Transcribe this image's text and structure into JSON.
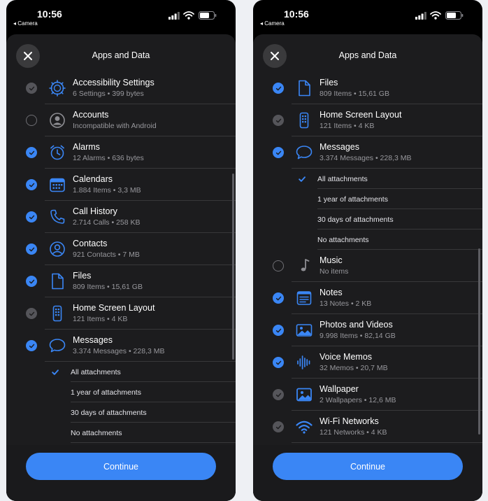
{
  "status": {
    "time": "10:56",
    "back_label": "◂ Camera"
  },
  "sheet": {
    "title": "Apps and Data",
    "continue_label": "Continue"
  },
  "left": [
    {
      "kind": "app",
      "name": "Accessibility Settings",
      "detail": "6 Settings • 399 bytes",
      "state": "gray",
      "icon": "accessibility-icon"
    },
    {
      "kind": "app",
      "name": "Accounts",
      "detail": "Incompatible with Android",
      "state": "off",
      "icon": "person-circle-icon"
    },
    {
      "kind": "app",
      "name": "Alarms",
      "detail": "12 Alarms • 636 bytes",
      "state": "on",
      "icon": "alarm-clock-icon"
    },
    {
      "kind": "app",
      "name": "Calendars",
      "detail": "1.884 Items • 3,3 MB",
      "state": "on",
      "icon": "calendar-icon"
    },
    {
      "kind": "app",
      "name": "Call History",
      "detail": "2.714 Calls • 258 KB",
      "state": "on",
      "icon": "phone-icon"
    },
    {
      "kind": "app",
      "name": "Contacts",
      "detail": "921 Contacts • 7 MB",
      "state": "on",
      "icon": "contact-icon"
    },
    {
      "kind": "app",
      "name": "Files",
      "detail": "809 Items • 15,61 GB",
      "state": "on",
      "icon": "file-icon"
    },
    {
      "kind": "app",
      "name": "Home Screen Layout",
      "detail": "121 Items • 4 KB",
      "state": "gray",
      "icon": "home-screen-icon"
    },
    {
      "kind": "app",
      "name": "Messages",
      "detail": "3.374 Messages • 228,3 MB",
      "state": "on",
      "icon": "message-bubble-icon"
    },
    {
      "kind": "sub",
      "label": "All attachments",
      "selected": true
    },
    {
      "kind": "sub",
      "label": "1 year of attachments",
      "selected": false
    },
    {
      "kind": "sub",
      "label": "30 days of attachments",
      "selected": false
    },
    {
      "kind": "sub",
      "label": "No attachments",
      "selected": false
    }
  ],
  "right": [
    {
      "kind": "app",
      "name": "Files",
      "detail": "809 Items • 15,61 GB",
      "state": "on",
      "icon": "file-icon"
    },
    {
      "kind": "app",
      "name": "Home Screen Layout",
      "detail": "121 Items • 4 KB",
      "state": "gray",
      "icon": "home-screen-icon"
    },
    {
      "kind": "app",
      "name": "Messages",
      "detail": "3.374 Messages • 228,3 MB",
      "state": "on",
      "icon": "message-bubble-icon"
    },
    {
      "kind": "sub",
      "label": "All attachments",
      "selected": true
    },
    {
      "kind": "sub",
      "label": "1 year of attachments",
      "selected": false
    },
    {
      "kind": "sub",
      "label": "30 days of attachments",
      "selected": false
    },
    {
      "kind": "sub",
      "label": "No attachments",
      "selected": false
    },
    {
      "kind": "app",
      "name": "Music",
      "detail": "No items",
      "state": "off",
      "icon": "music-note-icon"
    },
    {
      "kind": "app",
      "name": "Notes",
      "detail": "13 Notes • 2 KB",
      "state": "on",
      "icon": "notes-icon"
    },
    {
      "kind": "app",
      "name": "Photos and Videos",
      "detail": "9.998 Items • 82,14 GB",
      "state": "on",
      "icon": "photo-icon"
    },
    {
      "kind": "app",
      "name": "Voice Memos",
      "detail": "32 Memos • 20,7 MB",
      "state": "on",
      "icon": "waveform-icon"
    },
    {
      "kind": "app",
      "name": "Wallpaper",
      "detail": "2 Wallpapers • 12,6 MB",
      "state": "gray",
      "icon": "wallpaper-icon"
    },
    {
      "kind": "app",
      "name": "Wi-Fi Networks",
      "detail": "121 Networks • 4 KB",
      "state": "gray",
      "icon": "wifi-icon"
    }
  ],
  "colors": {
    "accent": "#3a86f5",
    "sheet": "#1c1c1e",
    "separator": "#38383a",
    "secondary_text": "#98989d"
  }
}
